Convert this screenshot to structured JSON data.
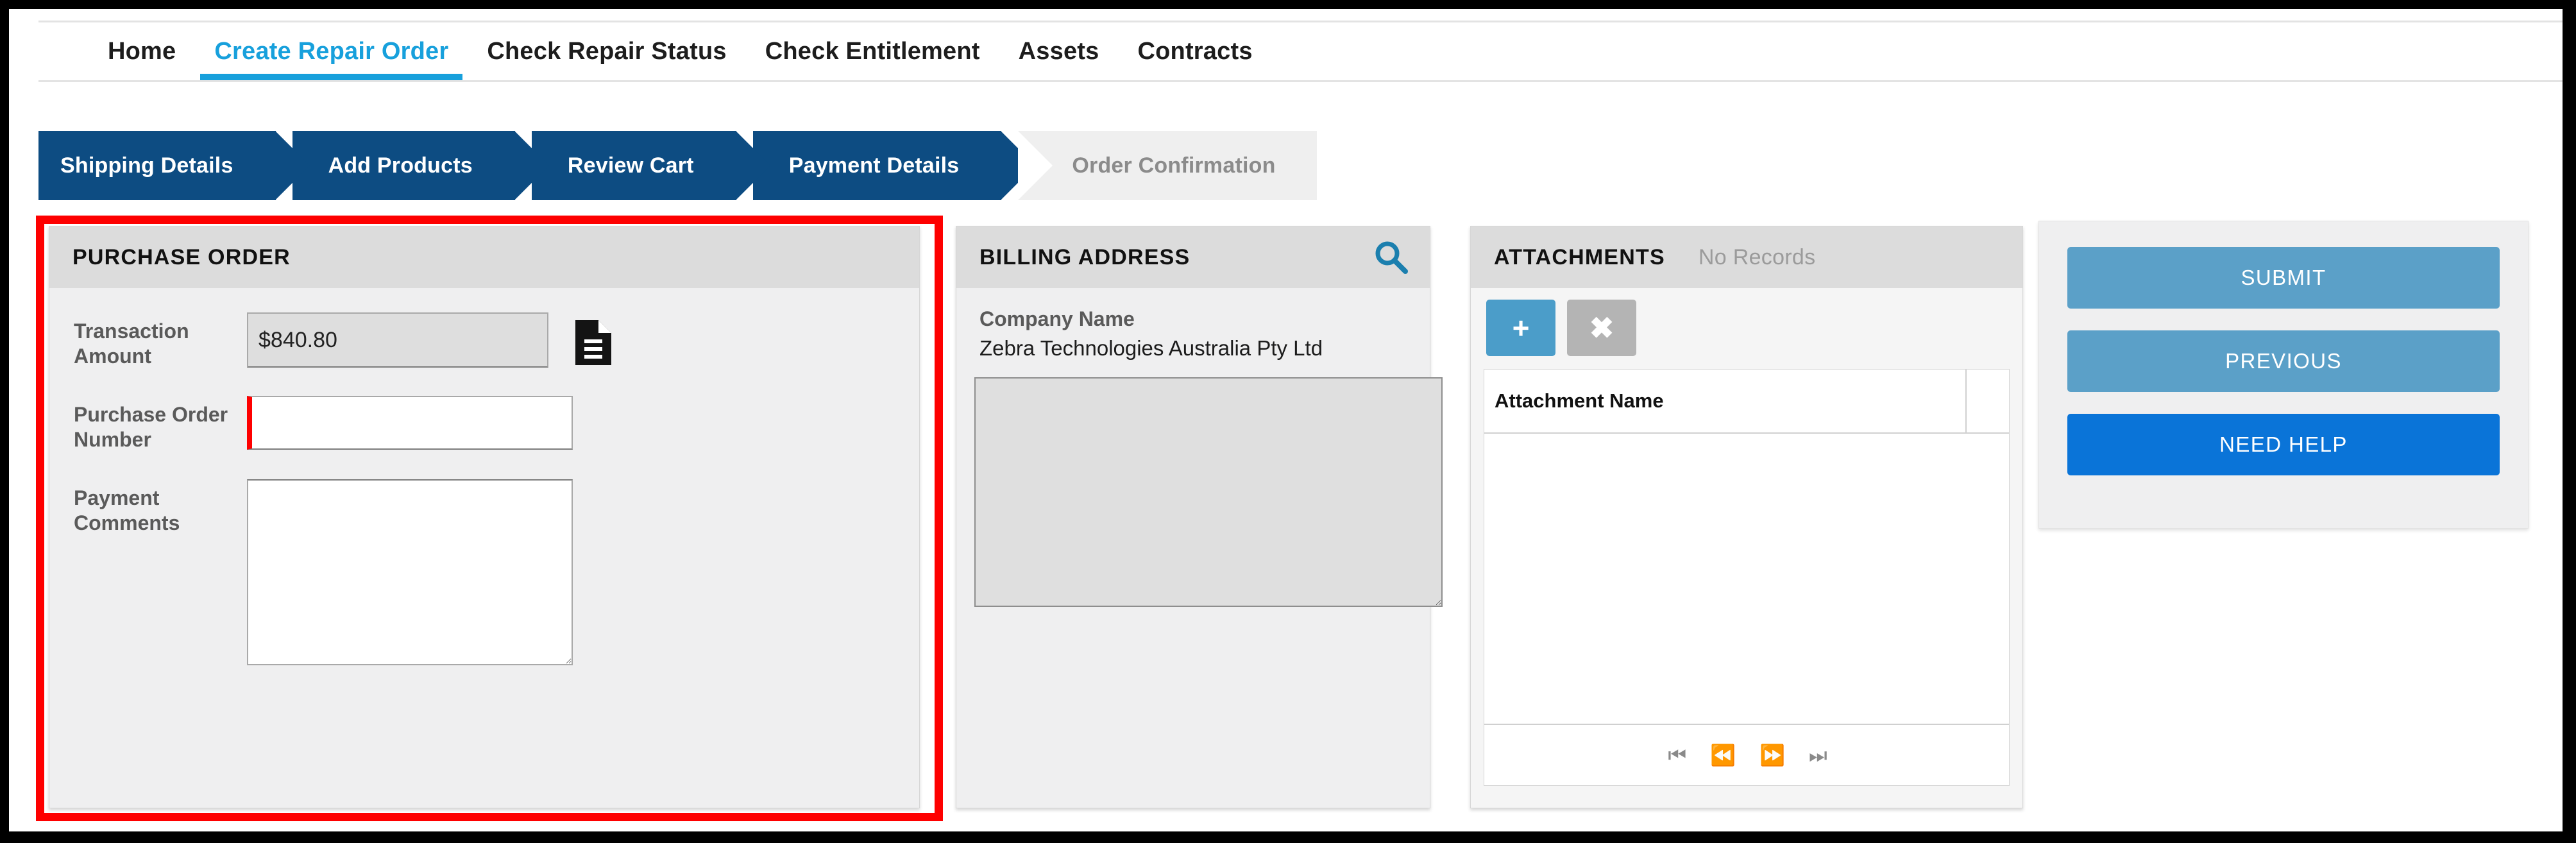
{
  "top_nav": {
    "items": [
      {
        "label": "Home",
        "active": false
      },
      {
        "label": "Create Repair Order",
        "active": true
      },
      {
        "label": "Check Repair Status",
        "active": false
      },
      {
        "label": "Check Entitlement",
        "active": false
      },
      {
        "label": "Assets",
        "active": false
      },
      {
        "label": "Contracts",
        "active": false
      }
    ],
    "active_color": "#17a0dc"
  },
  "wizard": {
    "steps": [
      {
        "label": "Shipping Details",
        "state": "completed"
      },
      {
        "label": "Add Products",
        "state": "completed"
      },
      {
        "label": "Review Cart",
        "state": "completed"
      },
      {
        "label": "Payment Details",
        "state": "current"
      },
      {
        "label": "Order Confirmation",
        "state": "upcoming"
      }
    ],
    "active_color": "#0d4c82",
    "inactive_color": "#efefef"
  },
  "highlight": {
    "color": "#fe0000",
    "target": "purchase-order-panel"
  },
  "purchase_order": {
    "title": "PURCHASE ORDER",
    "transaction_amount": {
      "label": "Transaction Amount",
      "value": "$840.80",
      "readonly": true
    },
    "document_icon": "document-icon",
    "purchase_order_number": {
      "label": "Purchase Order Number",
      "value": "",
      "placeholder": "",
      "required_marker_color": "#fe0000"
    },
    "payment_comments": {
      "label": "Payment Comments",
      "value": "",
      "placeholder": ""
    }
  },
  "billing_address": {
    "title": "BILLING ADDRESS",
    "search_icon": "search-icon",
    "search_icon_color": "#1b7fae",
    "company_name_label": "Company Name",
    "company_name_value": "Zebra Technologies Australia Pty Ltd",
    "address_value": "",
    "address_placeholder": ""
  },
  "attachments": {
    "title": "ATTACHMENTS",
    "status": "No Records",
    "add_button": "+",
    "remove_button": "✖",
    "columns": [
      "Attachment Name"
    ],
    "rows": [],
    "pager": {
      "first": "⏮",
      "previous": "⏪",
      "next": "⏩",
      "last": "⏭"
    }
  },
  "actions": {
    "submit_label": "SUBMIT",
    "previous_label": "PREVIOUS",
    "need_help_label": "NEED HELP",
    "secondary_color": "#5ba0c8",
    "primary_color": "#0a74d8"
  }
}
